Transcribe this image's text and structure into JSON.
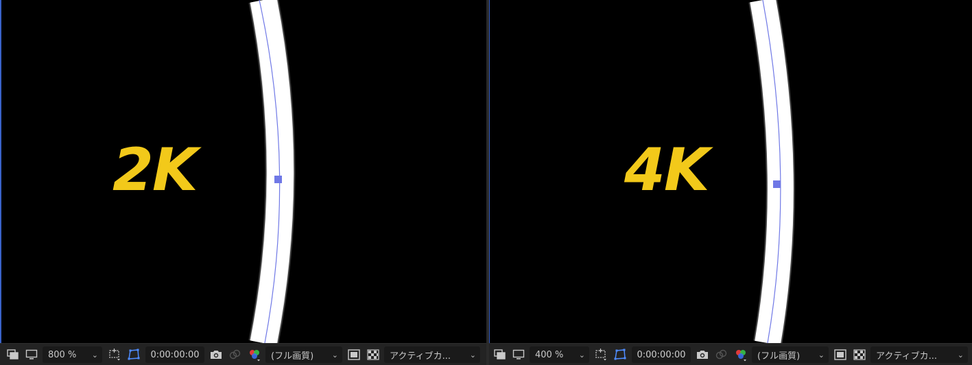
{
  "colors": {
    "viewer_bg": "#000000",
    "label_yellow": "#f2c91a",
    "path_blue": "#6f78e6",
    "toolbar_bg": "#232323",
    "active_border": "#3a62c8"
  },
  "panels": [
    {
      "resolution_label": "2K",
      "toolbar": {
        "zoom": "800 %",
        "timecode": "0:00:00:00",
        "quality": "(フル画質)",
        "camera": "アクティブカ..."
      }
    },
    {
      "resolution_label": "4K",
      "toolbar": {
        "zoom": "400 %",
        "timecode": "0:00:00:00",
        "quality": "(フル画質)",
        "camera": "アクティブカ..."
      }
    }
  ],
  "icons": {
    "preview_layers": "layers-icon",
    "display": "monitor-icon",
    "region_of_interest": "region-of-interest-icon",
    "mask_path_visibility": "mask-path-icon",
    "snapshot": "camera-icon",
    "show_snapshot": "show-snapshot-icon",
    "channels": "rgb-channels-icon",
    "fast_preview": "fast-preview-icon",
    "transparency_grid": "transparency-grid-icon"
  }
}
